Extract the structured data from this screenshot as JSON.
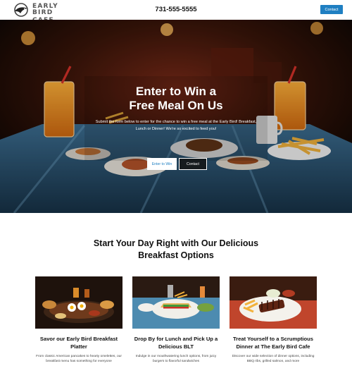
{
  "header": {
    "logo_line1": "EARLY BIRD",
    "logo_line2": "CAFE",
    "phone": "731-555-5555",
    "contact_label": "Contact"
  },
  "hero": {
    "title_line1": "Enter to Win a",
    "title_line2": "Free Meal On Us",
    "subtitle": "Submit the form below to enter for the chance to win a free meal at the Early Bird! Breakfast, Lunch or Dinner! We're so excited to feed you!",
    "enter_label": "Enter to Win",
    "contact_label": "Contact"
  },
  "section": {
    "title_line1": "Start Your Day Right with Our Delicious",
    "title_line2": "Breakfast Options"
  },
  "cards": [
    {
      "title": "Savor our Early Bird Breakfast Platter",
      "desc": "From classic American pancakes to hearty omelettes, our breakfast menu has something for everyone"
    },
    {
      "title": "Drop By for Lunch and Pick Up a Delicious BLT",
      "desc": "Indulge in our mouthwatering lunch options, from juicy burgers to flavorful sandwiches"
    },
    {
      "title": "Treat Yourself to a Scrumptious Dinner at The Early Bird Cafe",
      "desc": "Discover our wide selection of dinner options, including BBQ ribs, grilled salmon, and more"
    }
  ],
  "icons": {
    "logo": "bird-logo-icon"
  },
  "colors": {
    "accent": "#1f7fc2",
    "hero_dark": "#1a0d08"
  }
}
